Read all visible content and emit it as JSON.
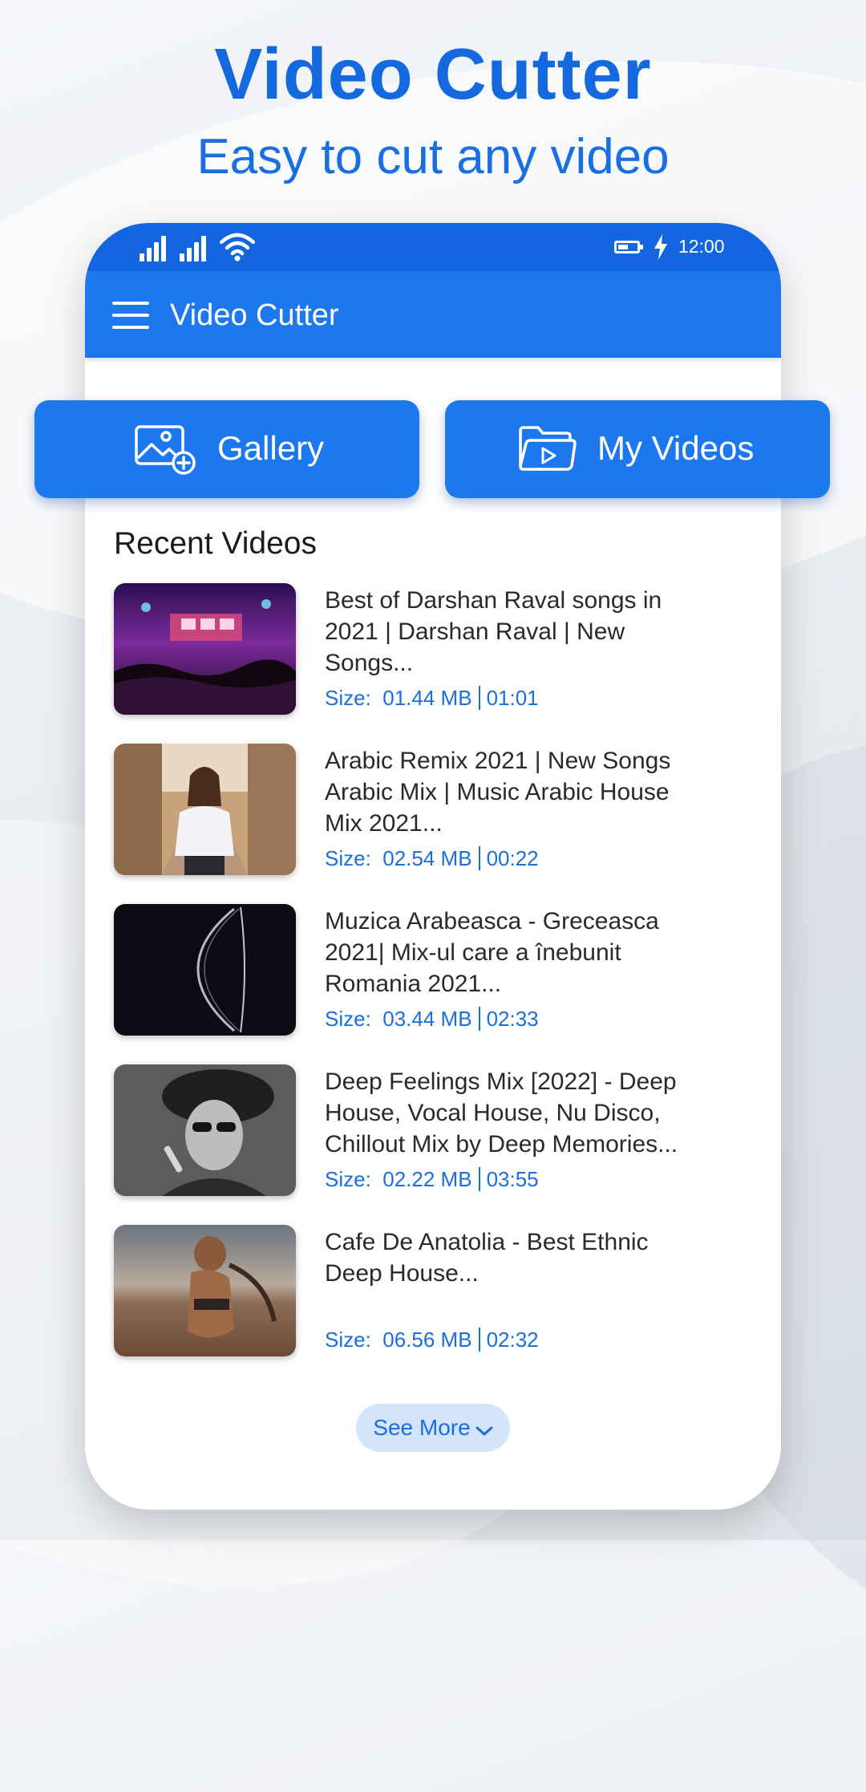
{
  "promo": {
    "title": "Video Cutter",
    "subtitle": "Easy to cut any video"
  },
  "status_bar": {
    "time": "12:00",
    "icons": [
      "signal-icon",
      "signal-icon",
      "wifi-icon",
      "battery-icon",
      "charging-icon"
    ]
  },
  "app_bar": {
    "menu_icon": "hamburger-menu-icon",
    "title": "Video Cutter"
  },
  "actions": {
    "gallery": {
      "label": "Gallery",
      "icon": "gallery-add-icon"
    },
    "my_videos": {
      "label": "My Videos",
      "icon": "video-folder-icon"
    }
  },
  "recent": {
    "title": "Recent Videos",
    "size_label": "Size:",
    "items": [
      {
        "title": "Best of Darshan Raval songs in 2021 | Darshan Raval | New Songs...",
        "size": "01.44 MB",
        "duration": "01:01"
      },
      {
        "title": "Arabic Remix 2021 | New Songs Arabic Mix | Music Arabic House Mix 2021...",
        "size": "02.54 MB",
        "duration": "00:22"
      },
      {
        "title": "Muzica Arabeasca - Greceasca 2021| Mix-ul care a înebunit Romania 2021...",
        "size": "03.44 MB",
        "duration": "02:33"
      },
      {
        "title": "Deep Feelings Mix [2022] - Deep House, Vocal House, Nu Disco, Chillout Mix by Deep Memories...",
        "size": "02.22 MB",
        "duration": "03:55"
      },
      {
        "title": "Cafe De Anatolia - Best Ethnic Deep House...",
        "size": "06.56 MB",
        "duration": "02:32"
      }
    ],
    "see_more": "See More"
  },
  "colors": {
    "primary": "#1d78ee",
    "status_bar": "#1366e0",
    "accent_text": "#1a6fe0",
    "see_more_bg": "#d3e4fb"
  }
}
